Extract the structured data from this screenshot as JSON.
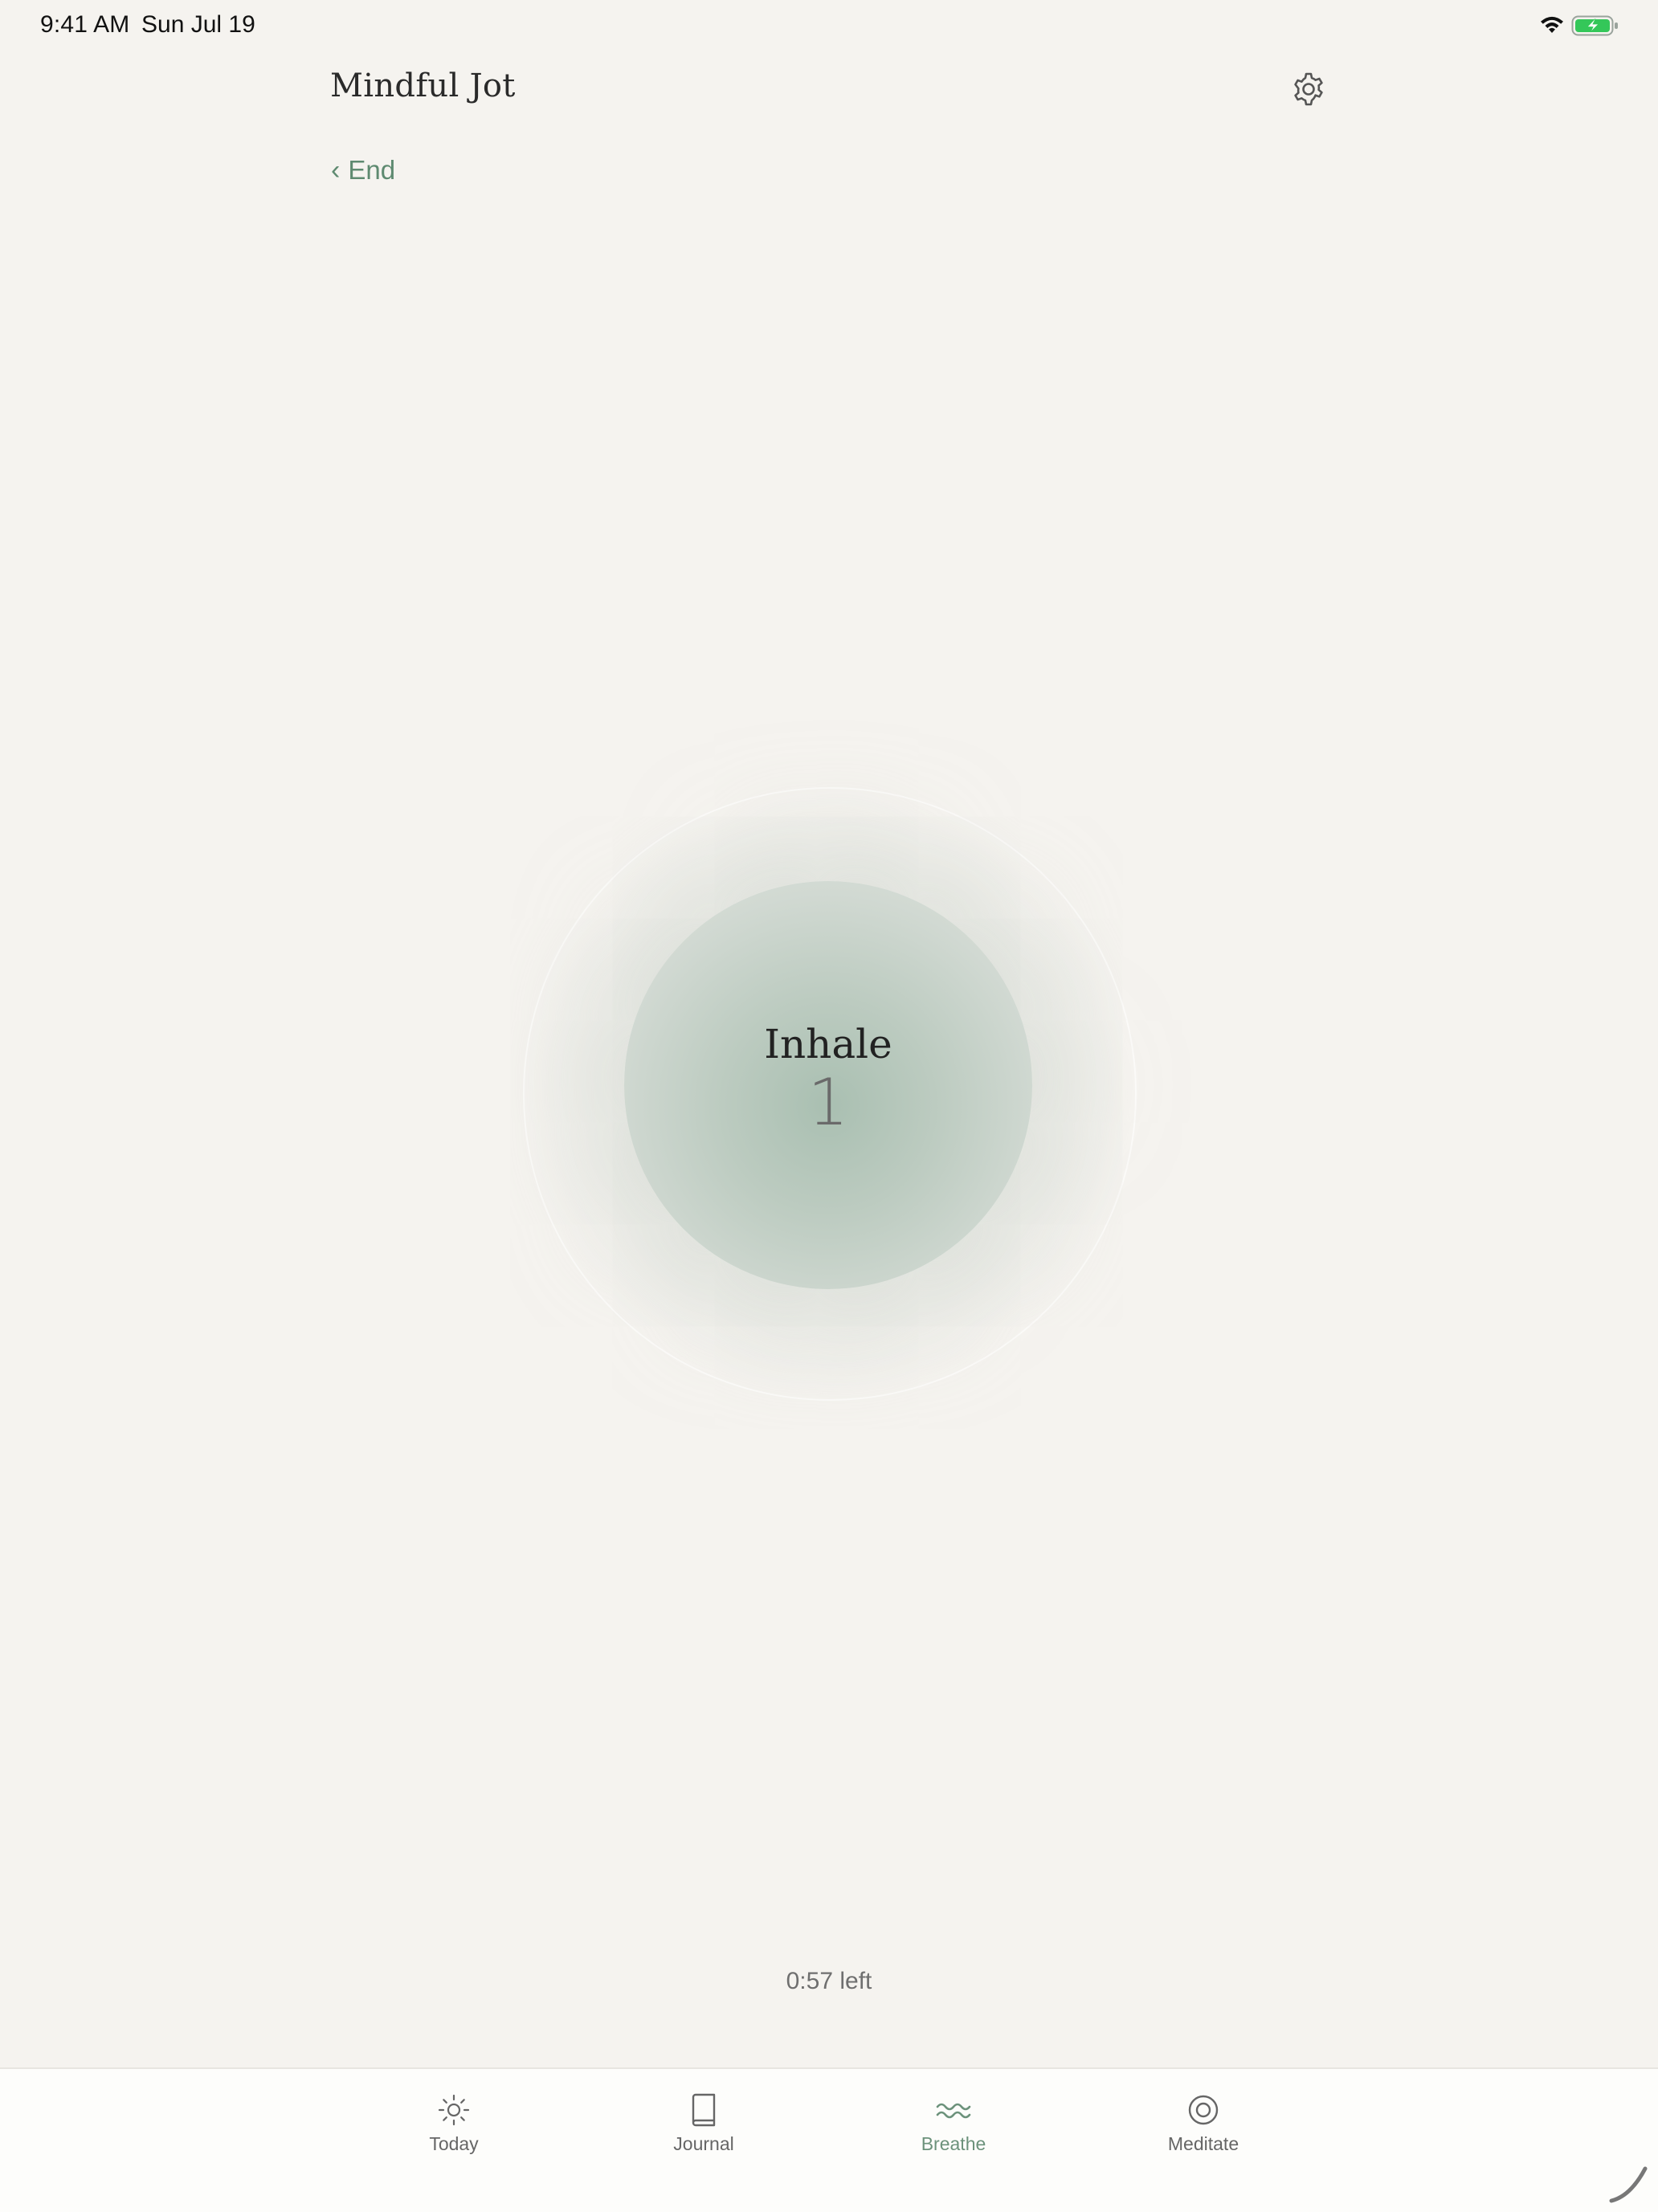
{
  "status_bar": {
    "time": "9:41 AM",
    "date": "Sun Jul 19",
    "battery_color": "#34c759"
  },
  "header": {
    "app_title": "Mindful Jot",
    "back_label": "End"
  },
  "session": {
    "phase": "Inhale",
    "count": "1",
    "time_left": "0:57 left"
  },
  "tabs": [
    {
      "label": "Today",
      "icon": "sun-icon",
      "active": false
    },
    {
      "label": "Journal",
      "icon": "book-icon",
      "active": false
    },
    {
      "label": "Breathe",
      "icon": "wave-icon",
      "active": true
    },
    {
      "label": "Meditate",
      "icon": "circle-target-icon",
      "active": false
    }
  ],
  "colors": {
    "background": "#f5f3ef",
    "accent": "#5e8a70",
    "circle": "#bccbc0"
  }
}
